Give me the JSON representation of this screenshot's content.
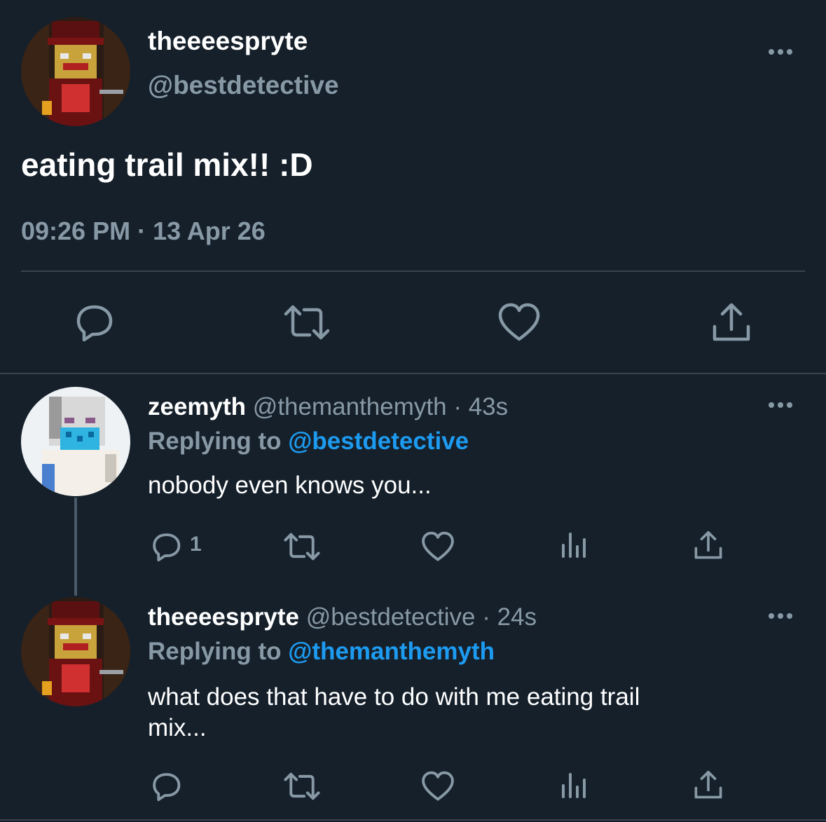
{
  "main_tweet": {
    "display_name": "theeeespryte",
    "handle": "@bestdetective",
    "text": "eating trail mix!! :D",
    "timestamp": "09:26 PM · 13 Apr 26",
    "more_icon": "more-horizontal-icon",
    "actions": [
      "reply-icon",
      "retweet-icon",
      "like-icon",
      "share-icon"
    ]
  },
  "replies": [
    {
      "display_name": "zeemyth",
      "handle": "@themanthemyth",
      "time": "· 43s",
      "replying_prefix": "Replying to",
      "replying_to": "@bestdetective",
      "text": "nobody even knows you...",
      "reply_count": "1"
    },
    {
      "display_name": "theeeespryte",
      "handle": "@bestdetective",
      "time": "· 24s",
      "replying_prefix": "Replying to",
      "replying_to": "@themanthemyth",
      "text_line1": "what does that have to do with me eating trail",
      "text_line2": "mix..."
    }
  ],
  "colors": {
    "background": "#15202b",
    "muted": "#8899a6",
    "accent": "#1d9bf0",
    "divider": "#38444d"
  }
}
